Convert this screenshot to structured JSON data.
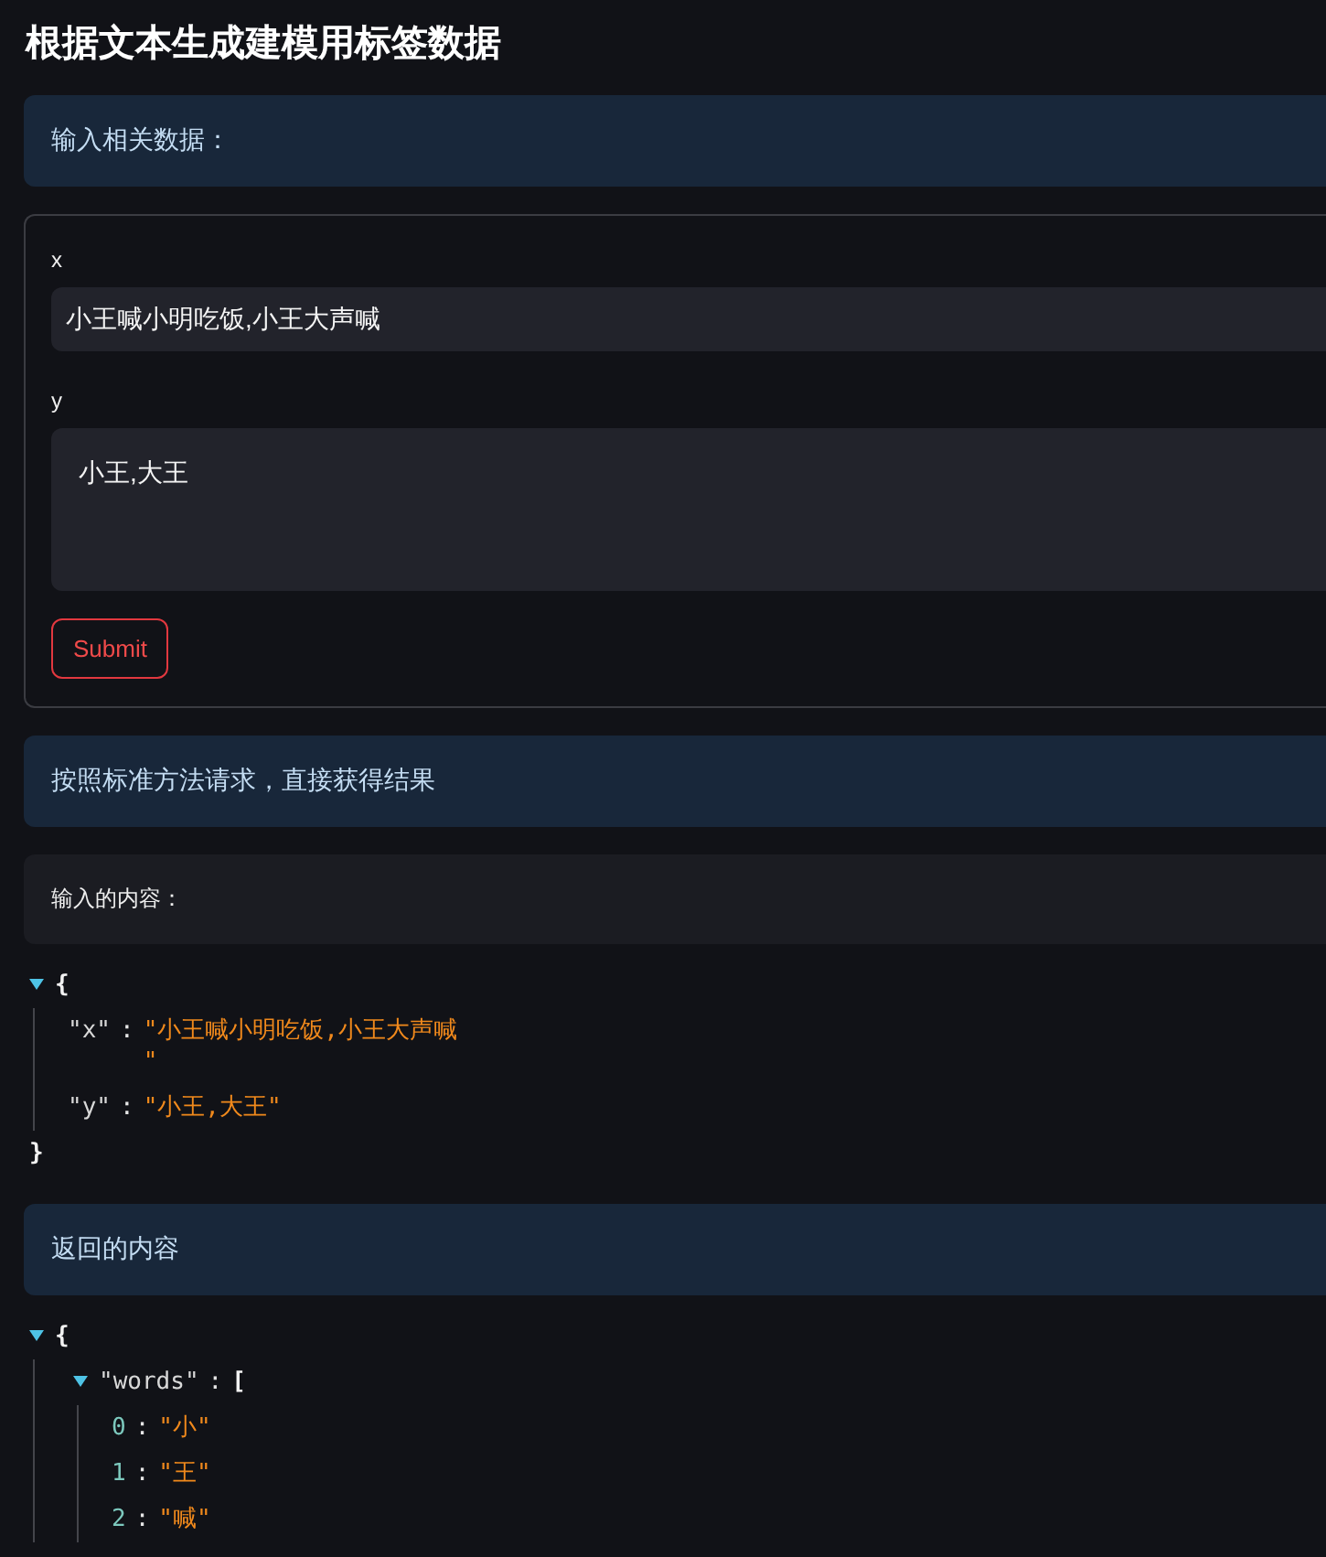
{
  "page": {
    "title": "根据文本生成建模用标签数据"
  },
  "sections": [
    {
      "kind": "banner",
      "text": "输入相关数据："
    },
    {
      "kind": "form",
      "fields": [
        {
          "kind": "input",
          "label": "x",
          "value": "小王喊小明吃饭,小王大声喊"
        },
        {
          "kind": "textarea",
          "label": "y",
          "value": "小王,大王"
        }
      ],
      "button": "Submit"
    },
    {
      "kind": "banner",
      "text": "按照标准方法请求，直接获得结果"
    },
    {
      "kind": "note",
      "text": "输入的内容："
    },
    {
      "kind": "json",
      "tree": {
        "kind": "object",
        "expanded": true,
        "open": "{",
        "close": "}",
        "children": [
          {
            "kind": "property",
            "key": "\"x\"",
            "sep": ":",
            "value": "\"小王喊小明吃饭,小王大声喊\n\""
          },
          {
            "kind": "property",
            "key": "\"y\"",
            "sep": ":",
            "value": "\"小王,大王\""
          }
        ]
      }
    },
    {
      "kind": "banner",
      "text": "返回的内容"
    },
    {
      "kind": "json",
      "tree": {
        "kind": "object",
        "expanded": true,
        "open": "{",
        "children": [
          {
            "kind": "array",
            "key": "\"words\"",
            "sep": ":",
            "open": "[",
            "expanded": true,
            "children": [
              {
                "kind": "index",
                "key": "0",
                "sep": ":",
                "value": "\"小\""
              },
              {
                "kind": "index",
                "key": "1",
                "sep": ":",
                "value": "\"王\""
              },
              {
                "kind": "index",
                "key": "2",
                "sep": ":",
                "value": "\"喊\""
              }
            ]
          }
        ]
      }
    }
  ]
}
